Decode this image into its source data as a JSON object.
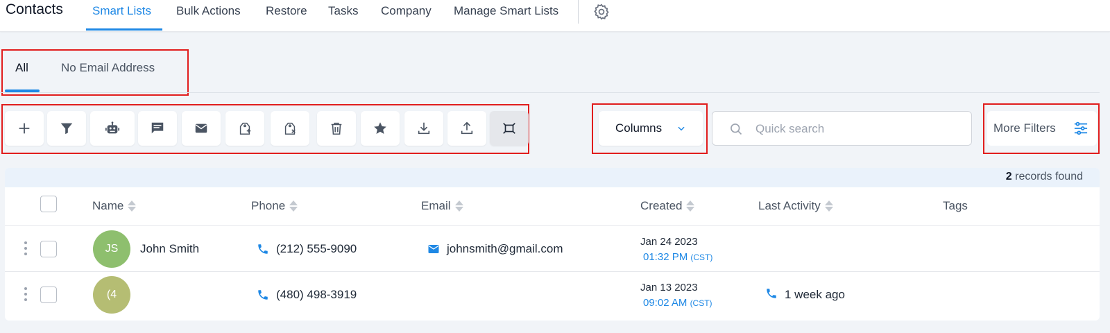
{
  "app": {
    "title": "Contacts"
  },
  "nav": {
    "items": [
      {
        "label": "Smart Lists",
        "active": true
      },
      {
        "label": "Bulk Actions"
      },
      {
        "label": "Restore"
      },
      {
        "label": "Tasks"
      },
      {
        "label": "Company"
      },
      {
        "label": "Manage Smart Lists"
      }
    ],
    "settings_icon": "gear-icon"
  },
  "tabs": [
    {
      "label": "All",
      "active": true
    },
    {
      "label": "No Email Address"
    }
  ],
  "toolbar": {
    "tools": [
      {
        "name": "add-contact-button",
        "icon": "plus-icon"
      },
      {
        "name": "filter-button",
        "icon": "filter-icon"
      },
      {
        "name": "automation-button",
        "icon": "robot-icon"
      },
      {
        "name": "send-sms-button",
        "icon": "message-icon"
      },
      {
        "name": "send-email-button",
        "icon": "mail-icon"
      },
      {
        "name": "add-tag-button",
        "icon": "tag-add-icon"
      },
      {
        "name": "remove-tag-button",
        "icon": "tag-remove-icon"
      },
      {
        "name": "delete-button",
        "icon": "trash-icon"
      },
      {
        "name": "review-button",
        "icon": "star-icon"
      },
      {
        "name": "export-button",
        "icon": "download-icon"
      },
      {
        "name": "import-button",
        "icon": "upload-icon"
      },
      {
        "name": "merge-button",
        "icon": "merge-icon",
        "selected": true
      }
    ],
    "columns_label": "Columns",
    "search_placeholder": "Quick search",
    "more_filters_label": "More Filters"
  },
  "table": {
    "records_count": "2",
    "records_suffix": "records found",
    "columns": [
      "Name",
      "Phone",
      "Email",
      "Created",
      "Last Activity",
      "Tags"
    ],
    "rows": [
      {
        "initials": "JS",
        "avatar_color": "#8ebf6e",
        "name": "John Smith",
        "phone": "(212) 555-9090",
        "email": "johnsmith@gmail.com",
        "created_date": "Jan 24 2023",
        "created_time": "01:32 PM",
        "created_tz": "(CST)",
        "last_activity": ""
      },
      {
        "initials": "(4",
        "avatar_color": "#b5bd73",
        "name": "",
        "phone": "(480) 498-3919",
        "email": "",
        "created_date": "Jan 13 2023",
        "created_time": "09:02 AM",
        "created_tz": "(CST)",
        "last_activity": "1 week ago"
      }
    ]
  },
  "colors": {
    "accent": "#1e88e5",
    "highlight_box": "#e11d1d"
  }
}
